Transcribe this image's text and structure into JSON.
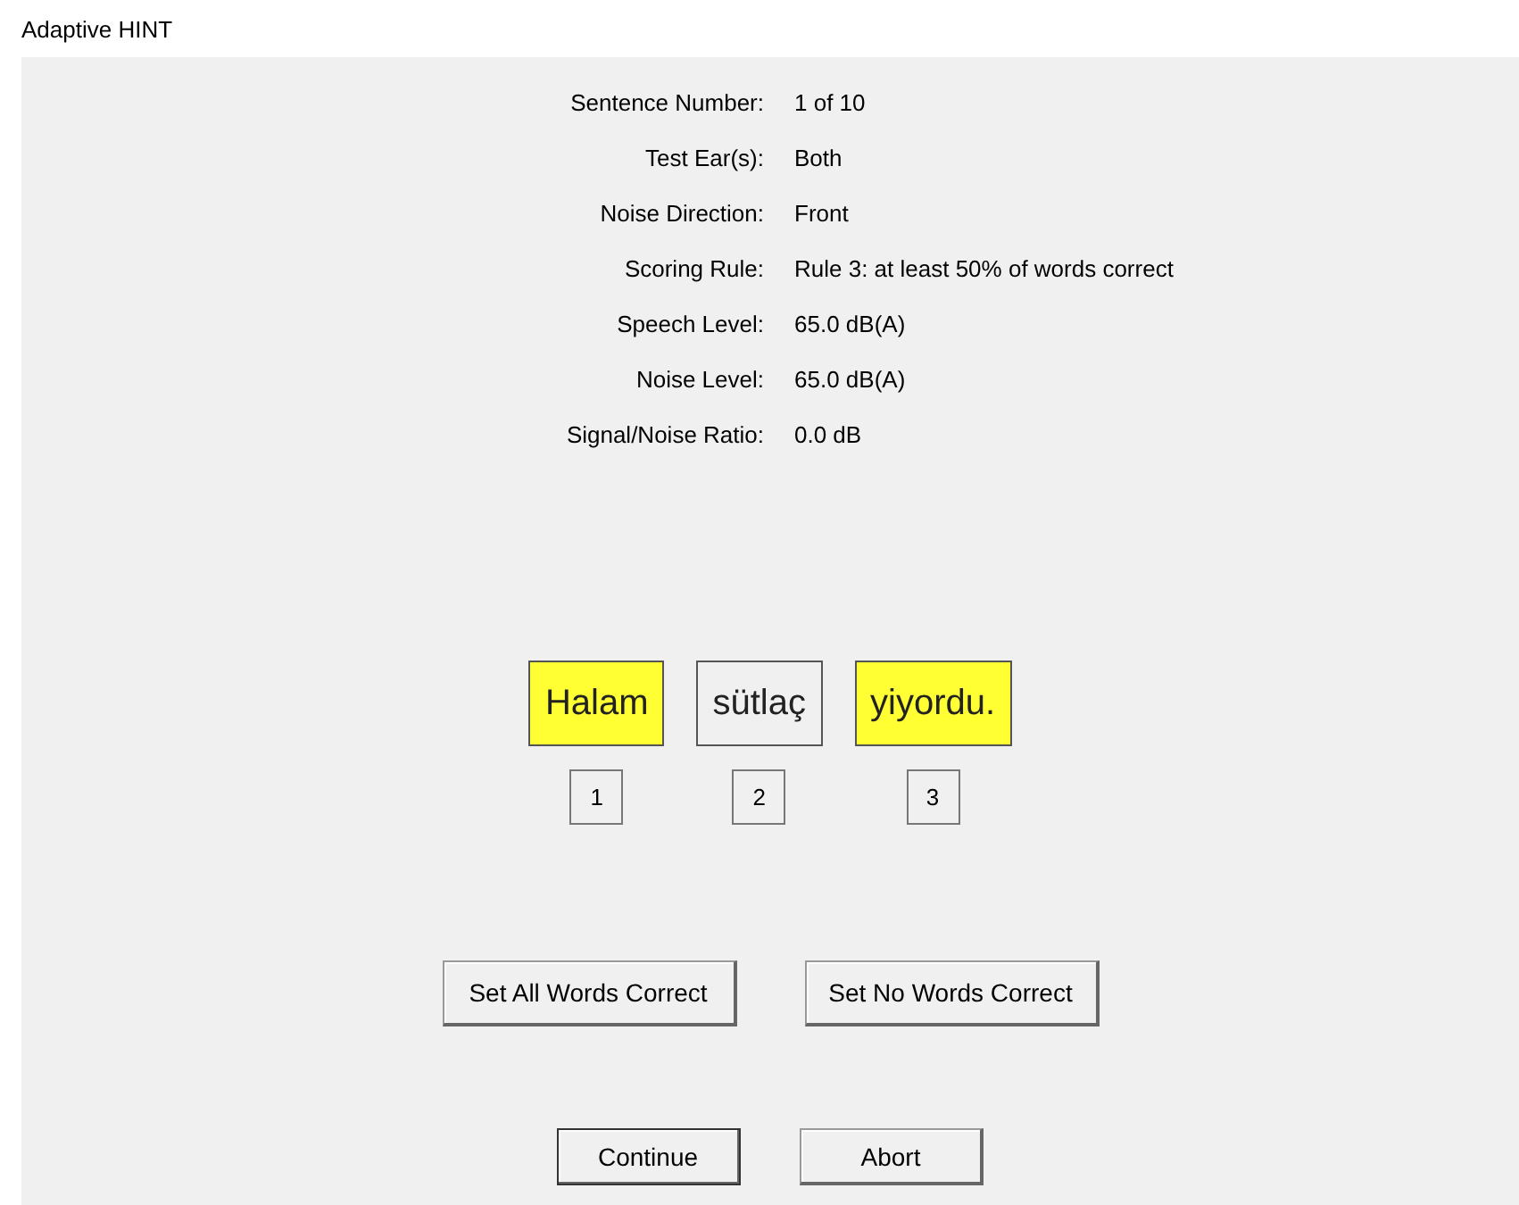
{
  "window": {
    "title": "Adaptive HINT"
  },
  "info": [
    {
      "label": "Sentence Number:",
      "value": "1 of 10"
    },
    {
      "label": "Test Ear(s):",
      "value": "Both"
    },
    {
      "label": "Noise Direction:",
      "value": "Front"
    },
    {
      "label": "Scoring Rule:",
      "value": "Rule 3: at least 50% of words correct"
    },
    {
      "label": "Speech Level:",
      "value": "65.0 dB(A)"
    },
    {
      "label": "Noise Level:",
      "value": "65.0 dB(A)"
    },
    {
      "label": "Signal/Noise Ratio:",
      "value": "0.0 dB"
    }
  ],
  "words": [
    {
      "text": "Halam",
      "number": "1",
      "selected": true
    },
    {
      "text": "sütlaç",
      "number": "2",
      "selected": false
    },
    {
      "text": "yiyordu.",
      "number": "3",
      "selected": true
    }
  ],
  "scoring_buttons": [
    {
      "label": "Set All Words Correct"
    },
    {
      "label": "Set No Words Correct"
    }
  ],
  "buttons": [
    {
      "label": "Continue",
      "default": true
    },
    {
      "label": "Abort",
      "default": false
    }
  ]
}
